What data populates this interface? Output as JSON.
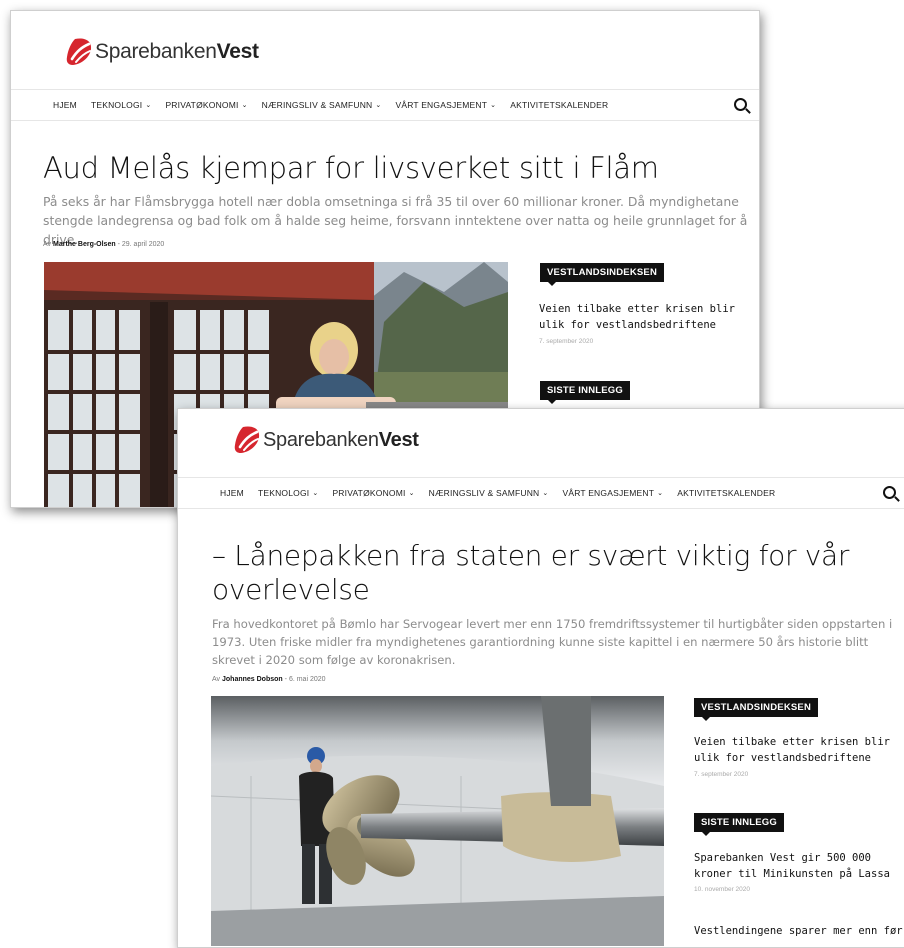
{
  "brand": {
    "name_regular": "Sparebanken",
    "name_bold": "Vest",
    "color": "#d6262e"
  },
  "nav": {
    "items": [
      {
        "label": "HJEM",
        "has_dropdown": false
      },
      {
        "label": "TEKNOLOGI",
        "has_dropdown": true
      },
      {
        "label": "PRIVATØKONOMI",
        "has_dropdown": true
      },
      {
        "label": "NÆRINGSLIV & SAMFUNN",
        "has_dropdown": true
      },
      {
        "label": "VÅRT ENGASJEMENT",
        "has_dropdown": true
      },
      {
        "label": "AKTIVITETSKALENDER",
        "has_dropdown": false
      }
    ],
    "search_icon": "search-icon",
    "dropdown_icon": "chevron-down-icon"
  },
  "screenshot1": {
    "article": {
      "title": "Aud Melås kjempar for livsverket sitt i Flåm",
      "lead": "På seks år har Flåmsbrygga hotell nær dobla omsetninga si frå 35 til over 60 millionar kroner. Då myndighetane stengde landegrensa og bad folk om å halde seg heime, forsvann inntektene over natta og heile grunnlaget for å drive.",
      "by_prefix": "Av",
      "author": "Marthe Berg-Olsen",
      "separator": "-",
      "date": "29. april 2020"
    },
    "sidebar": {
      "section1_label": "VESTLANDSINDEKSEN",
      "section1_title": "Veien tilbake etter krisen blir ulik for vestlandsbedriftene",
      "section1_date": "7. september 2020",
      "section2_label": "SISTE INNLEGG"
    }
  },
  "screenshot2": {
    "article": {
      "title": "– Lånepakken fra staten er svært viktig for vår overlevelse",
      "lead": "Fra hovedkontoret på Bømlo har Servogear levert mer enn 1750 fremdriftssystemer til hurtigbåter siden oppstarten i 1973. Uten friske midler fra myndighetenes garantiordning kunne siste kapittel i en nærmere 50 års historie blitt skrevet i 2020 som følge av koronakrisen.",
      "by_prefix": "Av",
      "author": "Johannes Dobson",
      "separator": "-",
      "date": "6. mai 2020"
    },
    "sidebar": {
      "section1_label": "VESTLANDSINDEKSEN",
      "section1_title": "Veien tilbake etter krisen blir ulik for vestlandsbedriftene",
      "section1_date": "7. september 2020",
      "section2_label": "SISTE INNLEGG",
      "section2_title": "Sparebanken Vest gir 500 000 kroner til Minikunsten på Lassa",
      "section2_date": "10. november 2020",
      "section3_title": "Vestlendingene sparer mer enn før"
    }
  }
}
